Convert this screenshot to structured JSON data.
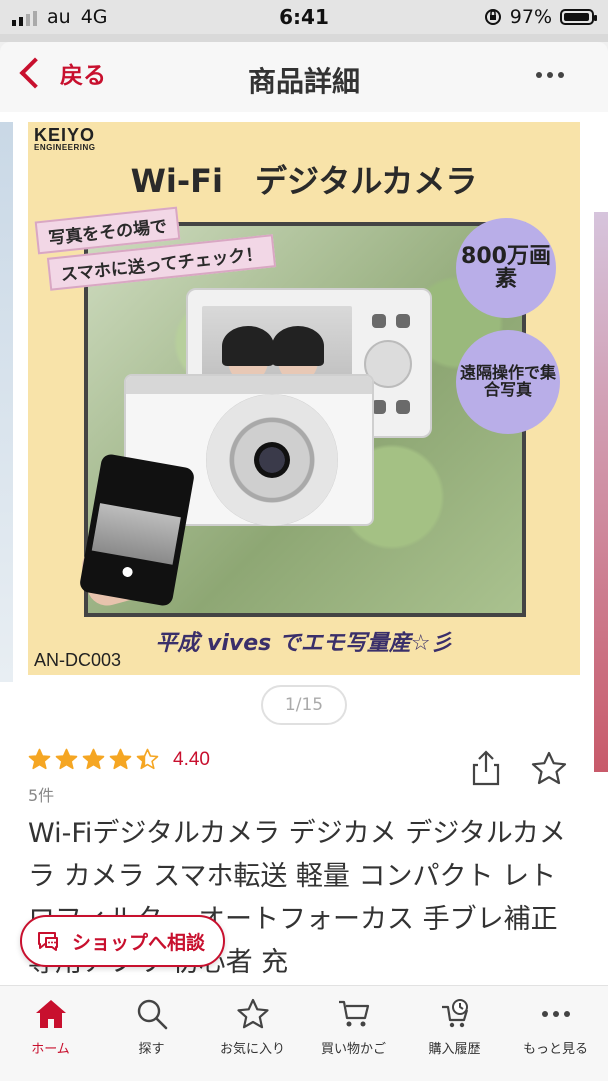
{
  "status_bar": {
    "carrier": "au",
    "network": "4G",
    "time": "6:41",
    "battery": "97%",
    "battery_level": 0.97
  },
  "nav": {
    "back_label": "戻る",
    "title": "商品詳細"
  },
  "product_image": {
    "brand_line1": "KEIYO",
    "brand_line2": "ENGINEERING",
    "headline": "Wi-Fi　デジタルカメラ",
    "tag_line1": "写真をその場で",
    "tag_line2": "スマホに送ってチェック！",
    "badge1": "800万画素",
    "badge2": "遠隔操作で集合写真",
    "caption": "平成 vives でエモ写量産☆彡",
    "model": "AN-DC003",
    "accent_color": "#c8102e"
  },
  "pager": {
    "text": "1/15",
    "current": 1,
    "total": 15
  },
  "rating": {
    "stars": 4.4,
    "value_text": "4.40",
    "review_count": "5件",
    "star_color": "#f5a623"
  },
  "product_title": "Wi-Fiデジタルカメラ デジカメ デジタルカメラ カメラ スマホ転送 軽量 コンパクト レトロフィルター オートフォーカス 手ブレ補正 専用アプリ 初心者 充",
  "consult_button": {
    "label": "ショップへ相談",
    "icon": "chat-icon"
  },
  "tabs": [
    {
      "label": "ホーム",
      "icon": "home-icon",
      "active": true
    },
    {
      "label": "探す",
      "icon": "search-icon",
      "active": false
    },
    {
      "label": "お気に入り",
      "icon": "star-icon",
      "active": false
    },
    {
      "label": "買い物かご",
      "icon": "cart-icon",
      "active": false
    },
    {
      "label": "購入履歴",
      "icon": "history-icon",
      "active": false
    },
    {
      "label": "もっと見る",
      "icon": "more-icon",
      "active": false
    }
  ]
}
